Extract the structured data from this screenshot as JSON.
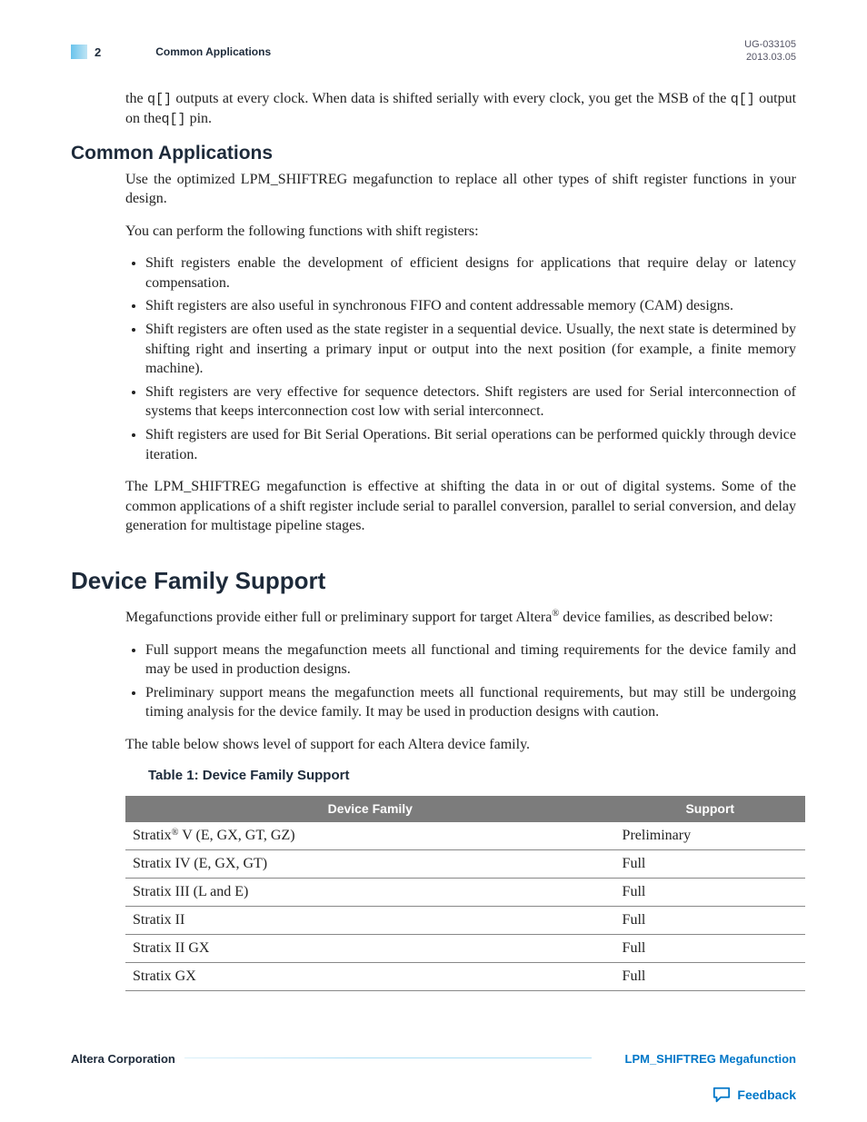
{
  "header": {
    "page_number": "2",
    "running_title": "Common Applications",
    "doc_id": "UG-033105",
    "date": "2013.03.05"
  },
  "intro_fragment": {
    "pre1": "the ",
    "code1": "q[]",
    "mid1": " outputs at every clock. When data is shifted serially with every clock, you get the MSB of the ",
    "code2": "q[]",
    "mid2": " output on the",
    "code3": "q[]",
    "post": " pin."
  },
  "sec1": {
    "title": "Common Applications",
    "p1": "Use the optimized LPM_SHIFTREG megafunction to replace all other types of shift register functions in your design.",
    "p2": "You can perform the following functions with shift registers:",
    "b1": "Shift registers enable the development of efficient designs for applications that require delay or latency compensation.",
    "b2": "Shift registers are also useful in synchronous FIFO and content addressable memory (CAM) designs.",
    "b3": "Shift registers are often used as the state register in a sequential device. Usually, the next state is determined by shifting right and inserting a primary input or output into the next position (for example, a finite memory machine).",
    "b4": "Shift registers are very effective for sequence detectors. Shift registers are used for Serial interconnection of systems that keeps interconnection cost low with serial interconnect.",
    "b5": "Shift registers are used for Bit Serial Operations. Bit serial operations can be performed quickly through device iteration.",
    "p3": "The LPM_SHIFTREG megafunction is effective at shifting the data in or out of digital systems. Some of the common applications of a shift register include serial to parallel conversion, parallel to serial conversion, and delay generation for multistage pipeline stages."
  },
  "sec2": {
    "title": "Device Family Support",
    "p1_pre": "Megafunctions provide either full or preliminary support for target Altera",
    "p1_post": " device families, as described below:",
    "b1": "Full support means the megafunction meets all functional and timing requirements for the device family and may be used in production designs.",
    "b2": "Preliminary support means the megafunction meets all functional requirements, but may still be undergoing timing analysis for the device family. It may be used in production designs with caution.",
    "p2": "The table below shows level of support for each Altera device family.",
    "table_title": "Table 1: Device Family Support",
    "table": {
      "headers": [
        "Device Family",
        "Support"
      ],
      "rows": [
        {
          "family_pre": "Stratix",
          "family_reg": true,
          "family_post": " V (E, GX, GT, GZ)",
          "support": "Preliminary"
        },
        {
          "family_pre": "Stratix IV (E, GX, GT)",
          "family_reg": false,
          "family_post": "",
          "support": "Full"
        },
        {
          "family_pre": "Stratix III (L and E)",
          "family_reg": false,
          "family_post": "",
          "support": "Full"
        },
        {
          "family_pre": "Stratix II",
          "family_reg": false,
          "family_post": "",
          "support": "Full"
        },
        {
          "family_pre": "Stratix II GX",
          "family_reg": false,
          "family_post": "",
          "support": "Full"
        },
        {
          "family_pre": "Stratix GX",
          "family_reg": false,
          "family_post": "",
          "support": "Full"
        }
      ]
    }
  },
  "footer": {
    "left": "Altera Corporation",
    "right": "LPM_SHIFTREG Megafunction",
    "feedback": "Feedback"
  }
}
